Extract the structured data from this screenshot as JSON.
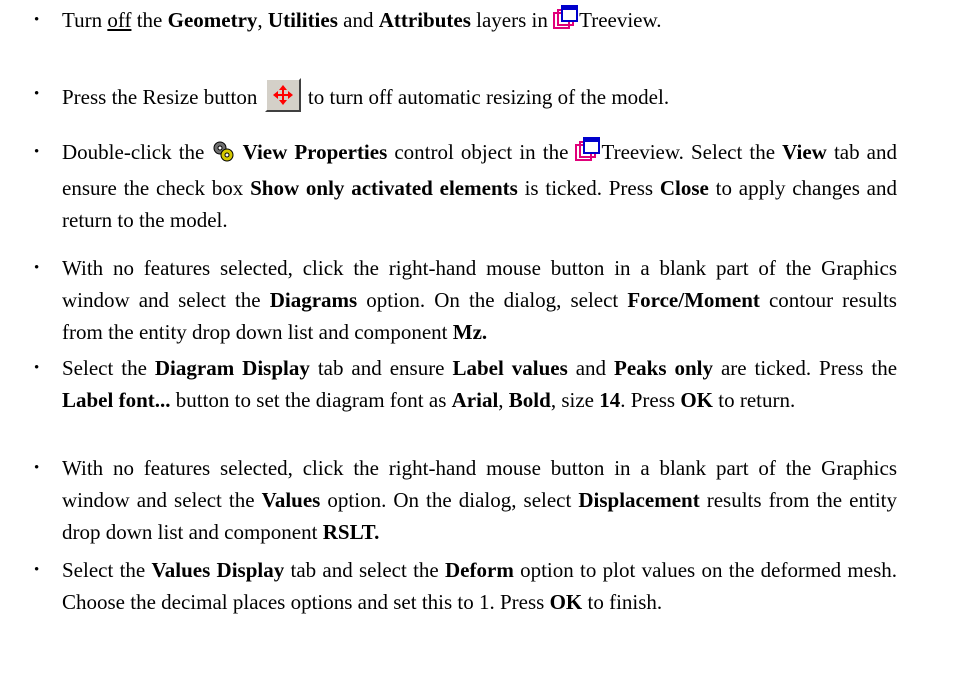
{
  "steps": [
    {
      "p1": "Turn ",
      "off": "off",
      "p2": " the ",
      "geometry": "Geometry",
      "c1": ", ",
      "utilities": "Utilities",
      "and": " and ",
      "attributes": "Attributes",
      "p3": " layers in ",
      "treeview": "Treeview."
    },
    {
      "p1": "Press the Resize button",
      "p2": "to turn off automatic resizing of the model."
    },
    {
      "p1": "Double-click the",
      "view_properties": "View Properties",
      "p2": " control object in the ",
      "p3": "Treeview. Select the ",
      "view": "View",
      "p4": " tab and ensure the check box ",
      "show_only": "Show only activated elements",
      "p5": " is ticked. Press ",
      "close": "Close",
      "p6": " to apply changes and return to the model."
    },
    {
      "p1": "With no features selected, click the right-hand mouse button in a blank part of the Graphics window and select the ",
      "diagrams": "Diagrams",
      "p2": " option. On the dialog, select ",
      "force_moment": "Force/Moment",
      "p3": " contour results from the entity drop down list and component ",
      "mz": "Mz."
    },
    {
      "p1": "Select the ",
      "diagram_display": "Diagram Display",
      "p2": " tab and ensure ",
      "label_values": "Label values",
      "p3": " and ",
      "peaks_only": "Peaks only",
      "p4": " are ticked. Press the ",
      "label_font": "Label font...",
      "p5": " button to set the diagram font as ",
      "arial": "Arial",
      "c1": ", ",
      "bold": "Bold",
      "p6": ", size ",
      "size": "14",
      "p7": ". Press ",
      "ok": "OK",
      "p8": " to return."
    },
    {
      "p1": "With no features selected, click the right-hand mouse button in a blank part of the Graphics window and select the ",
      "values": "Values",
      "p2": " option. On the dialog, select ",
      "displacement": "Displacement",
      "p3": " results from the entity drop down list and component ",
      "rslt": "RSLT."
    },
    {
      "p1": "Select the ",
      "values_display": "Values Display",
      "p2": " tab and select the ",
      "deform": "Deform",
      "p3": " option to plot values on the deformed mesh. Choose the decimal places options and set this to 1. Press ",
      "ok": "OK",
      "p4": " to finish."
    }
  ],
  "bullet_char": "•",
  "icons": {
    "treeview": "treeview-icon",
    "resize": "resize-button-icon",
    "view_properties": "view-properties-gears-icon"
  },
  "colors": {
    "treeview_icon": "#e0007a",
    "resize_arrows": "#ff0000",
    "button_face": "#d4d0c8"
  }
}
